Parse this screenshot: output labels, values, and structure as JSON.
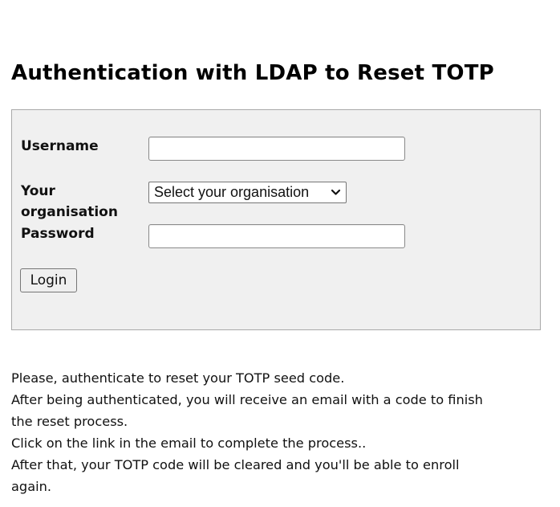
{
  "page": {
    "title": "Authentication with LDAP to Reset TOTP"
  },
  "form": {
    "username_label": "Username",
    "username_value": "",
    "organisation_label": "Your organisation",
    "organisation_label_line1": "Your",
    "organisation_label_line2": "organisation",
    "organisation_select": {
      "selected": "Select your organisation",
      "icon": "chevron-down-icon"
    },
    "password_label": "Password",
    "password_value": "",
    "login_button": "Login"
  },
  "info": {
    "lines": [
      "Please, authenticate to reset your TOTP seed code.",
      "After being authenticated, you will receive an email with a code to finish",
      "the reset process.",
      "Click on the link in the email to complete the process..",
      "After that, your TOTP code will be cleared and you'll be able to enroll",
      "again."
    ]
  },
  "colors": {
    "panel_background": "#f0f0f0",
    "panel_border": "#a9a9a9",
    "text": "#111111"
  }
}
